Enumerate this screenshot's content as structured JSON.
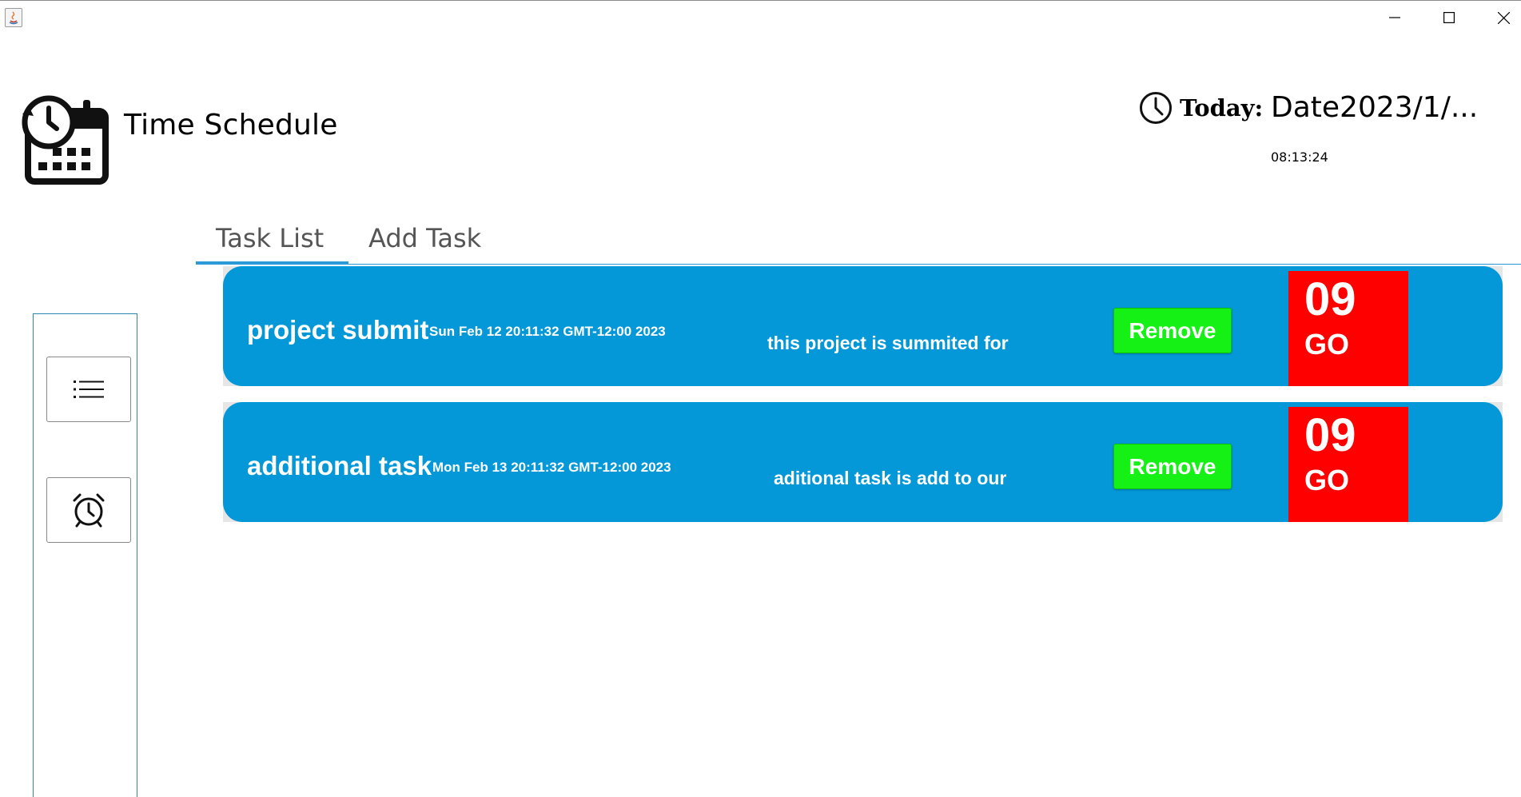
{
  "window": {
    "minimize_symbol": "—",
    "close_symbol": "✕"
  },
  "header": {
    "title": "Time Schedule",
    "today_label": "Today:",
    "date_value": "Date2023/1/...",
    "time_value": "08:13:24"
  },
  "tabs": [
    {
      "label": "Task List",
      "active": true
    },
    {
      "label": "Add Task",
      "active": false
    }
  ],
  "sidebar": {
    "buttons": [
      {
        "icon": "list-icon"
      },
      {
        "icon": "alarm-clock-icon"
      }
    ]
  },
  "tasks": [
    {
      "name": "project submit",
      "date": "Sun Feb 12 20:11:32 GMT-12:00 2023",
      "description": "this project is summited for",
      "remove_label": "Remove",
      "count": "09",
      "go_label": "GO"
    },
    {
      "name": "additional task",
      "date": "Mon Feb 13 20:11:32 GMT-12:00 2023",
      "description": "aditional task is add to our",
      "remove_label": "Remove",
      "count": "09",
      "go_label": "GO"
    }
  ],
  "colors": {
    "card": "#0498d8",
    "remove_button": "#15f015",
    "counter": "#ff0000",
    "tab_accent": "#2b9ad6"
  }
}
